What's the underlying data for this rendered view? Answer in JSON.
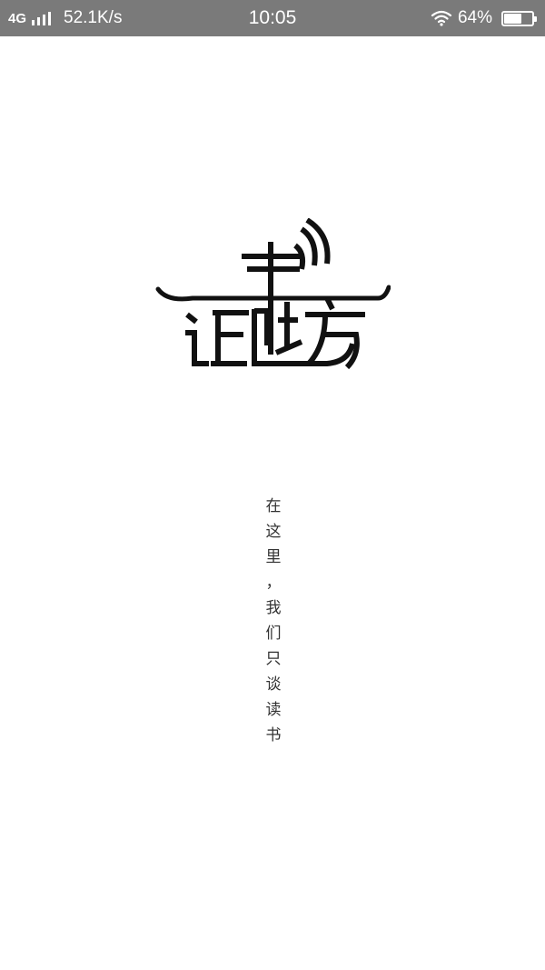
{
  "status_bar": {
    "network": "4G",
    "speed": "52.1K/s",
    "time": "10:05",
    "battery_percent_label": "64%",
    "battery_level": 0.64,
    "icons": [
      "signal-icon",
      "wifi-icon",
      "battery-icon"
    ]
  },
  "splash": {
    "logo_text": "御书坊",
    "tagline_chars": [
      "在",
      "这",
      "里",
      "，",
      "我",
      "们",
      "只",
      "谈",
      "读",
      "书"
    ]
  },
  "colors": {
    "status_bar_bg": "#7a7a7a",
    "background": "#ffffff",
    "logo": "#111111",
    "tagline": "#333333"
  }
}
